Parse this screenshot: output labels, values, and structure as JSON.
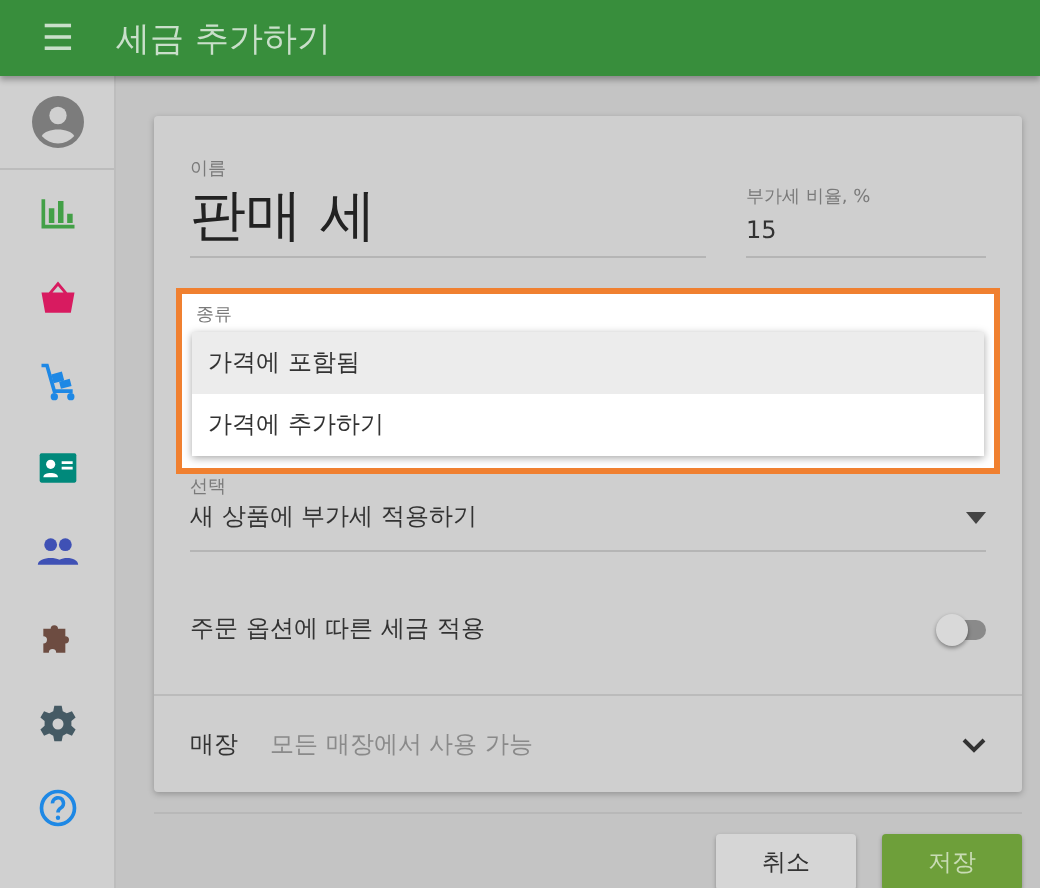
{
  "app_bar": {
    "menu_icon": "☰",
    "title": "세금 추가하기"
  },
  "form": {
    "name": {
      "label": "이름",
      "value": "판매 세"
    },
    "rate": {
      "label": "부가세 비율, %",
      "value": "15"
    },
    "type": {
      "label": "종류",
      "options": [
        {
          "label": "가격에 포함됨",
          "selected": true
        },
        {
          "label": "가격에 추가하기",
          "selected": false
        }
      ]
    },
    "apply": {
      "label": "선택",
      "value": "새 상품에 부가세 적용하기"
    },
    "order_option": {
      "label": "주문 옵션에 따른 세금 적용",
      "on": false
    },
    "store": {
      "label": "매장",
      "value": "모든 매장에서 사용 가능"
    }
  },
  "buttons": [
    {
      "label": "취소",
      "kind": "secondary"
    },
    {
      "label": "저장",
      "kind": "primary"
    }
  ]
}
